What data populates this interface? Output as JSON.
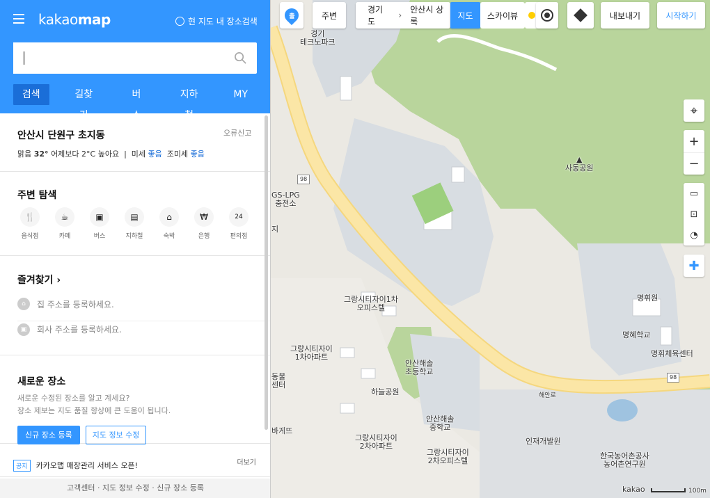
{
  "app": {
    "logo_light": "kakao",
    "logo_bold": "map",
    "current_search": "현 지도 내 장소검색"
  },
  "search": {
    "value": "",
    "placeholder": ""
  },
  "tabs": [
    "검색",
    "길찾기",
    "버스",
    "지하철",
    "MY"
  ],
  "weather": {
    "location": "안산시 단원구 초지동",
    "report": "오류신고",
    "cond": "맑음",
    "temp": "32°",
    "compare": "어제보다 2°C 높아요",
    "dust_label": "미세",
    "dust_val": "좋음",
    "fine_label": "조미세",
    "fine_val": "좋음"
  },
  "nearby": {
    "title": "주변 탐색",
    "items": [
      {
        "label": "음식점",
        "icon": "restaurant-icon"
      },
      {
        "label": "카페",
        "icon": "cafe-icon"
      },
      {
        "label": "버스",
        "icon": "bus-icon"
      },
      {
        "label": "지하철",
        "icon": "subway-icon"
      },
      {
        "label": "숙박",
        "icon": "hotel-icon"
      },
      {
        "label": "은행",
        "icon": "bank-icon"
      },
      {
        "label": "편의점",
        "icon": "store-24-icon"
      }
    ]
  },
  "favorites": {
    "title": "즐겨찾기",
    "home": "집 주소를 등록하세요.",
    "work": "회사 주소를 등록하세요."
  },
  "newplace": {
    "title": "새로운 장소",
    "line1": "새로운 수정된 장소를 알고 계세요?",
    "line2": "장소 제보는 지도 품질 향상에 큰 도움이 됩니다.",
    "btn_register": "신규 장소 등록",
    "btn_edit": "지도 정보 수정"
  },
  "notice": {
    "tag": "공지",
    "text": "카카오맵 매장관리 서비스 오픈!",
    "more": "더보기"
  },
  "footer": {
    "a": "고객센터",
    "b": "지도 정보 수정",
    "c": "신규 장소 등록",
    "sep": "·"
  },
  "maptop": {
    "start_badge": "출",
    "nearby": "주변",
    "crumb1": "경기도",
    "crumb2": "안산시 상록",
    "view_map": "지도",
    "view_sky": "스카이뷰",
    "export": "내보내기",
    "start": "시작하기"
  },
  "map_labels": {
    "techno": "경기\n테크노파크",
    "park": "사동공원",
    "gs": "GS-LPG\n충전소",
    "road98": "98",
    "haean": "해안로",
    "grang1": "그랑시티자이1차\n오피스텔",
    "grang1a": "그랑시티자이\n1차아파트",
    "grang2a": "그랑시티자이\n2차아파트",
    "grang2o": "그랑시티자이\n2차오피스텔",
    "haean_el": "안산해솔\n초등학교",
    "haean_mid": "안산해솔\n중학교",
    "haneul": "하늘공원",
    "myunghwi": "명휘원",
    "myunghye": "명혜학교",
    "myunghwi_ctr": "명휘체육센터",
    "injae": "인재개발원",
    "nonghyup": "한국농어촌공사\n농어촌연구원",
    "dong": "동물\n센터",
    "bakery": "바게뜨",
    "scale": "100m",
    "kakao": "kakao",
    "g_ji": "지"
  },
  "colors": {
    "accent": "#3396ff",
    "road": "#f8dc8a",
    "green": "#b6d49a",
    "water": "#9fc3e0"
  }
}
